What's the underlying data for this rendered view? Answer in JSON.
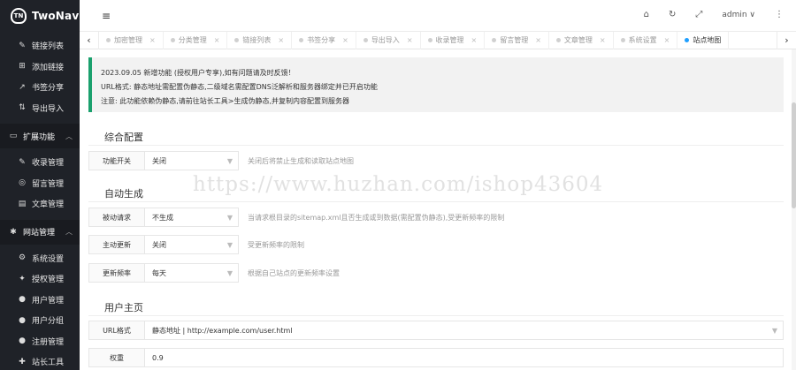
{
  "app": {
    "name": "TwoNav",
    "logo_letters": "TN"
  },
  "sidebar": {
    "items_top": [
      {
        "icon": "✎",
        "label": "链接列表"
      },
      {
        "icon": "⊞",
        "label": "添加链接"
      },
      {
        "icon": "↗",
        "label": "书签分享"
      },
      {
        "icon": "⇅",
        "label": "导出导入"
      }
    ],
    "group1": {
      "icon": "▭",
      "label": "扩展功能",
      "chevron": "︿"
    },
    "items_mid": [
      {
        "icon": "✎",
        "label": "收录管理"
      },
      {
        "icon": "◎",
        "label": "留言管理"
      },
      {
        "icon": "▤",
        "label": "文章管理"
      }
    ],
    "group2": {
      "icon": "✱",
      "label": "网站管理",
      "chevron": "︿"
    },
    "items_bottom": [
      {
        "icon": "⚙",
        "label": "系统设置"
      },
      {
        "icon": "✦",
        "label": "授权管理"
      },
      {
        "icon": "●",
        "label": "用户管理"
      },
      {
        "icon": "●",
        "label": "用户分组"
      },
      {
        "icon": "●",
        "label": "注册管理"
      },
      {
        "icon": "✚",
        "label": "站长工具"
      }
    ]
  },
  "header": {
    "menu_icon": "≡",
    "home_icon": "⌂",
    "refresh_icon": "↻",
    "fullscreen_icon": "⤢",
    "user": "admin ∨",
    "more_icon": "⋮"
  },
  "tabs": {
    "left_arrow": "‹",
    "right_arrow": "›",
    "close": "×",
    "items": [
      {
        "label": "加密管理"
      },
      {
        "label": "分类管理"
      },
      {
        "label": "链接列表"
      },
      {
        "label": "书签分享"
      },
      {
        "label": "导出导入"
      },
      {
        "label": "收录管理"
      },
      {
        "label": "留言管理"
      },
      {
        "label": "文章管理"
      },
      {
        "label": "系统设置"
      },
      {
        "label": "站点地图"
      }
    ]
  },
  "notice": {
    "line1": "2023.09.05 新增功能 (授权用户专享),如有问题请及时反馈！",
    "line2": "URL格式: 静态地址需配置伪静态,二级域名需配置DNS泛解析和服务器绑定并已开启功能",
    "line3": "注意: 此功能依赖伪静态,请前往站长工具>生成伪静态,并复制内容配置到服务器"
  },
  "sections": {
    "general": "综合配置",
    "auto": "自动生成",
    "user_home": "用户主页"
  },
  "form": {
    "switch": {
      "label": "功能开关",
      "value": "关闭",
      "hint": "关闭后将禁止生成和读取站点地图"
    },
    "passive": {
      "label": "被动请求",
      "value": "不生成",
      "hint": "当请求根目录的sitemap.xml且否生成或到数据(需配置伪静态),受更新频率的限制"
    },
    "active": {
      "label": "主动更新",
      "value": "关闭",
      "hint": "受更新频率的限制"
    },
    "freq": {
      "label": "更新频率",
      "value": "每天",
      "hint": "根据自己站点的更新频率设置"
    },
    "url_format": {
      "label": "URL格式",
      "value": "静态地址 | http://example.com/user.html"
    },
    "weight": {
      "label": "权重",
      "value": "0.9"
    }
  },
  "watermark": "https://www.huzhan.com/ishop43604",
  "colors": {
    "sidebar_bg": "#1f2228",
    "accent": "#1aa06d",
    "active_tab_dot": "#1e9fff"
  }
}
